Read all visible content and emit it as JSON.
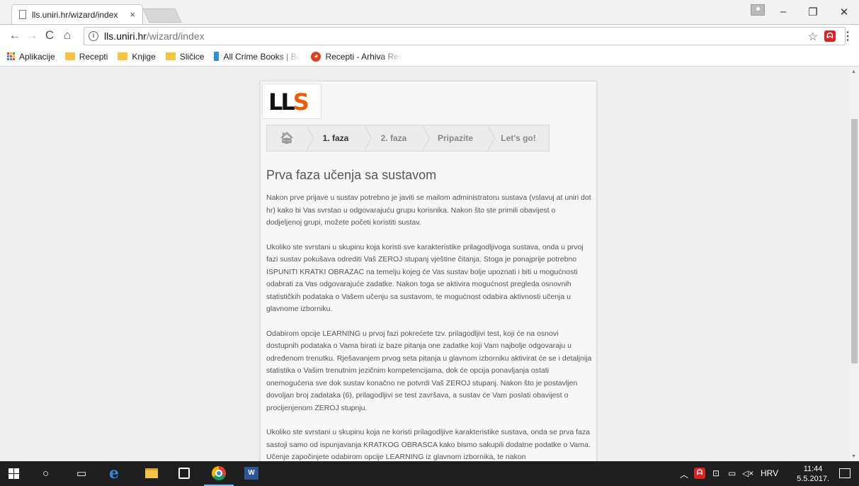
{
  "browser": {
    "tab_title": "lls.uniri.hr/wizard/index",
    "tab_close": "×",
    "url_host": "lls.uniri.hr",
    "url_path": "/wizard/index",
    "window_controls": {
      "minimize": "–",
      "maximize": "❐",
      "close": "✕"
    },
    "nav": {
      "back": "←",
      "forward": "→",
      "reload": "C",
      "home": "⌂"
    },
    "star": "☆",
    "menu": "⋮"
  },
  "bookmarks": [
    {
      "label": "Aplikacije",
      "icon": "apps-grid-icon"
    },
    {
      "label": "Recepti",
      "icon": "folder-icon"
    },
    {
      "label": "Knjige",
      "icon": "folder-icon"
    },
    {
      "label": "Sličice",
      "icon": "folder-icon"
    },
    {
      "label": "All Crime Books | Boo",
      "icon": "bookmark-icon"
    },
    {
      "label": "Recepti - Arhiva Rece",
      "icon": "recipes-site-icon"
    }
  ],
  "page": {
    "logo_text": "LLS",
    "wizard_steps": [
      {
        "label": "",
        "icon": "home-icon"
      },
      {
        "label": "1. faza",
        "active": true
      },
      {
        "label": "2. faza",
        "active": false
      },
      {
        "label": "Pripazite",
        "active": false
      },
      {
        "label": "Let's go!",
        "active": false
      }
    ],
    "heading": "Prva faza učenja sa sustavom",
    "paragraphs": [
      "Nakon prve prijave u sustav potrebno je javiti se mailom administratoru sustava (vslavuj at uniri dot hr) kako bi Vas svrstao u odgovarajuću grupu korisnika. Nakon što ste primili obavijest o dodjeljenoj grupi, možete početi koristiti sustav.",
      "Ukoliko ste svrstani u skupinu koja koristi sve karakteristike prilagodljivoga sustava, onda u prvoj fazi sustav pokušava odrediti Vaš ZEROJ stupanj vještine čitanja. Stoga je ponajprije potrebno ISPUNITI KRATKI OBRAZAC na temelju kojeg će Vas sustav bolje upoznati i biti u mogućnosti odabrati za Vas odgovarajuće zadatke. Nakon toga se aktivira mogućnost pregleda osnovnih statističkih podataka o Vašem učenju sa sustavom, te mogućnost odabira aktivnosti učenja u glavnome izborniku.",
      "Odabirom opcije LEARNING u prvoj fazi pokrećete tzv. prilagodljivi test, koji će na osnovi dostupnih podataka o Vama birati iz baze pitanja one zadatke koji Vam najbolje odgovaraju u određenom trenutku. Rješavanjem prvog seta pitanja u glavnom izborniku aktivirat će se i detaljnija statistika o Vašim trenutnim jezičnim kompetencijama, dok će opcija ponavljanja ostati onemogućena sve dok sustav konačno ne potvrdi Vaš ZEROJ stupanj. Nakon što je postavljen dovoljan broj zadataka (6), prilagodljivi se test završava, a sustav će Vam poslati obavijest o procijenjenom ZEROJ stupnju.",
      "Ukoliko ste svrstani u skupinu koja ne koristi prilagodljive karakteristike sustava, onda se prva faza sastoji samo od ispunjavanja KRATKOG OBRASCA kako bismo sakupili dodatne podatke o Vama. Učenje započinjete odabirom opcije LEARNING iz glavnom izbornika, te nakon"
    ]
  },
  "taskbar": {
    "language": "HRV",
    "time": "11:44",
    "date": "5.5.2017."
  }
}
